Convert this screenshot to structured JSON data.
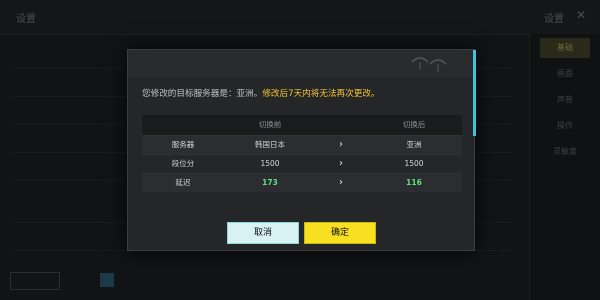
{
  "background": {
    "title": "设置",
    "settings_label": "设置",
    "close_glyph": "✕",
    "right_items": [
      "基础",
      "画面",
      "声音",
      "操作",
      "灵敏度"
    ],
    "rows": [
      "",
      "",
      "",
      "",
      "",
      "",
      ""
    ]
  },
  "dialog": {
    "notice_normal": "您修改的目标服务器是：亚洲。",
    "notice_warning": "修改后7天内将无法再次更改。",
    "table": {
      "header_before": "切换前",
      "header_after": "切换后",
      "arrow": "›",
      "rows": [
        {
          "label": "服务器",
          "before": "韩国日本",
          "after": "亚洲"
        },
        {
          "label": "段位分",
          "before": "1500",
          "after": "1500"
        },
        {
          "label": "延迟",
          "before": "173",
          "after": "116"
        }
      ]
    },
    "cancel_label": "取消",
    "confirm_label": "确定"
  },
  "colors": {
    "warning_text": "#f4c533",
    "ping_good": "#5fe07a",
    "confirm_button": "#f6e020",
    "cancel_button": "#d8f2f2",
    "accent": "#3fc4e0"
  }
}
